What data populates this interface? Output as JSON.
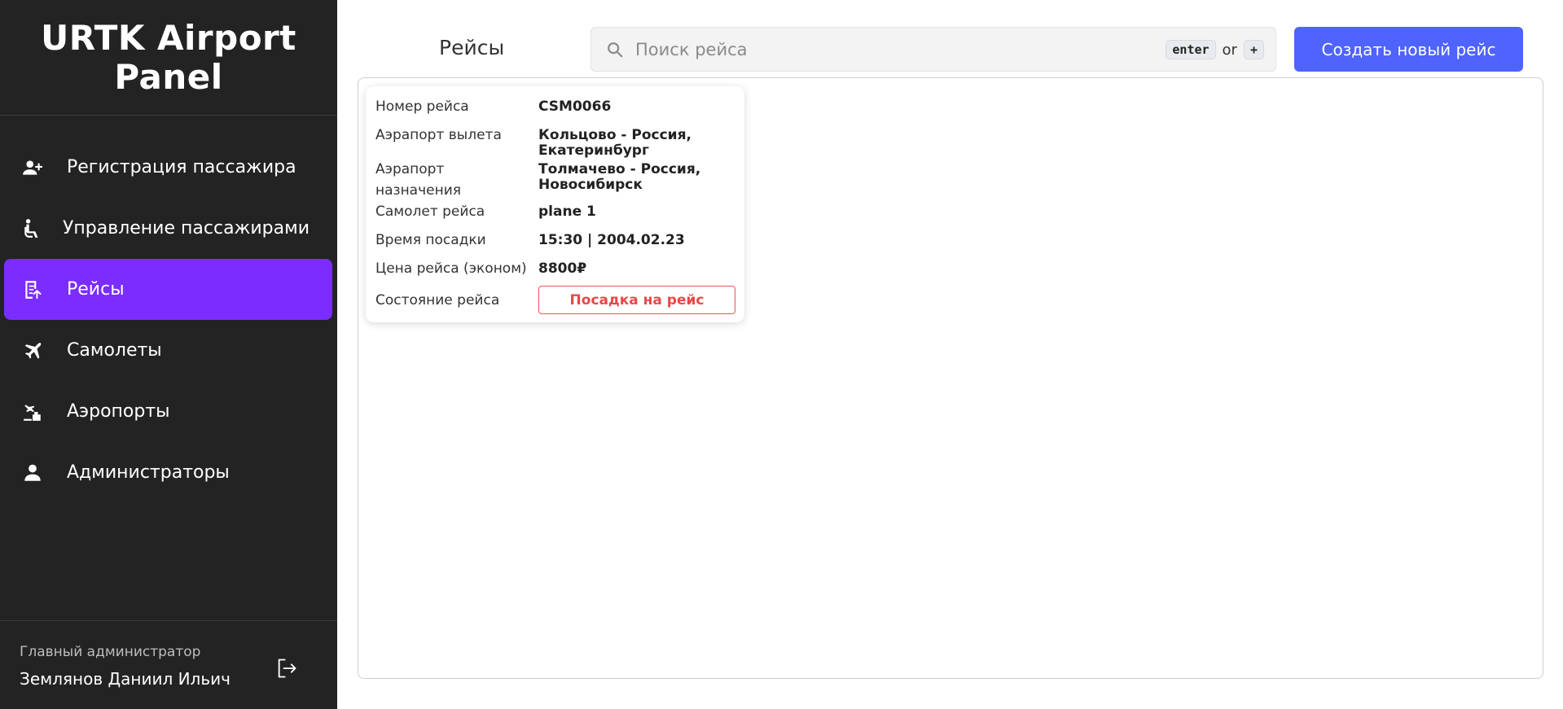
{
  "brand": {
    "title": "URTK Airport Panel"
  },
  "sidebar": {
    "items": [
      {
        "label": "Регистрация пассажира",
        "icon": "add-user-icon"
      },
      {
        "label": "Управление пассажирами",
        "icon": "accessible-seat-icon"
      },
      {
        "label": "Рейсы",
        "icon": "flight-list-icon",
        "active": true
      },
      {
        "label": "Самолеты",
        "icon": "airplane-icon"
      },
      {
        "label": "Аэропорты",
        "icon": "airport-icon"
      },
      {
        "label": "Администраторы",
        "icon": "person-icon"
      }
    ],
    "active_color": "#7b2cff",
    "background_color": "#232323"
  },
  "footer": {
    "role": "Главный администратор",
    "user": "Землянов Даниил Ильич",
    "logout_icon": "logout-icon"
  },
  "header": {
    "title": "Рейсы",
    "search_placeholder": "Поиск рейса",
    "hint_key1": "enter",
    "hint_or": "or",
    "hint_key2": "+",
    "create_label": "Создать новый рейс",
    "create_color": "#4f63ff"
  },
  "flight_card": {
    "number_label": "Номер рейса",
    "number": "CSM0066",
    "departure_label": "Аэрапорт вылета",
    "departure_line1": "Кольцово - Россия,",
    "departure_line2": "Екатеринбург",
    "destination_label_line1": "Аэрапорт",
    "destination_label_line2": "назначения",
    "destination_line1": "Толмачево - Россия,",
    "destination_line2": "Новосибирск",
    "plane_label": "Самолет рейса",
    "plane": "plane 1",
    "boarding_label": "Время посадки",
    "boarding": "15:30 | 2004.02.23",
    "price_label": "Цена рейса (эконом)",
    "price": "8800₽",
    "state_label": "Состояние рейса",
    "state": "Посадка на рейс",
    "state_color": "#e84848"
  }
}
